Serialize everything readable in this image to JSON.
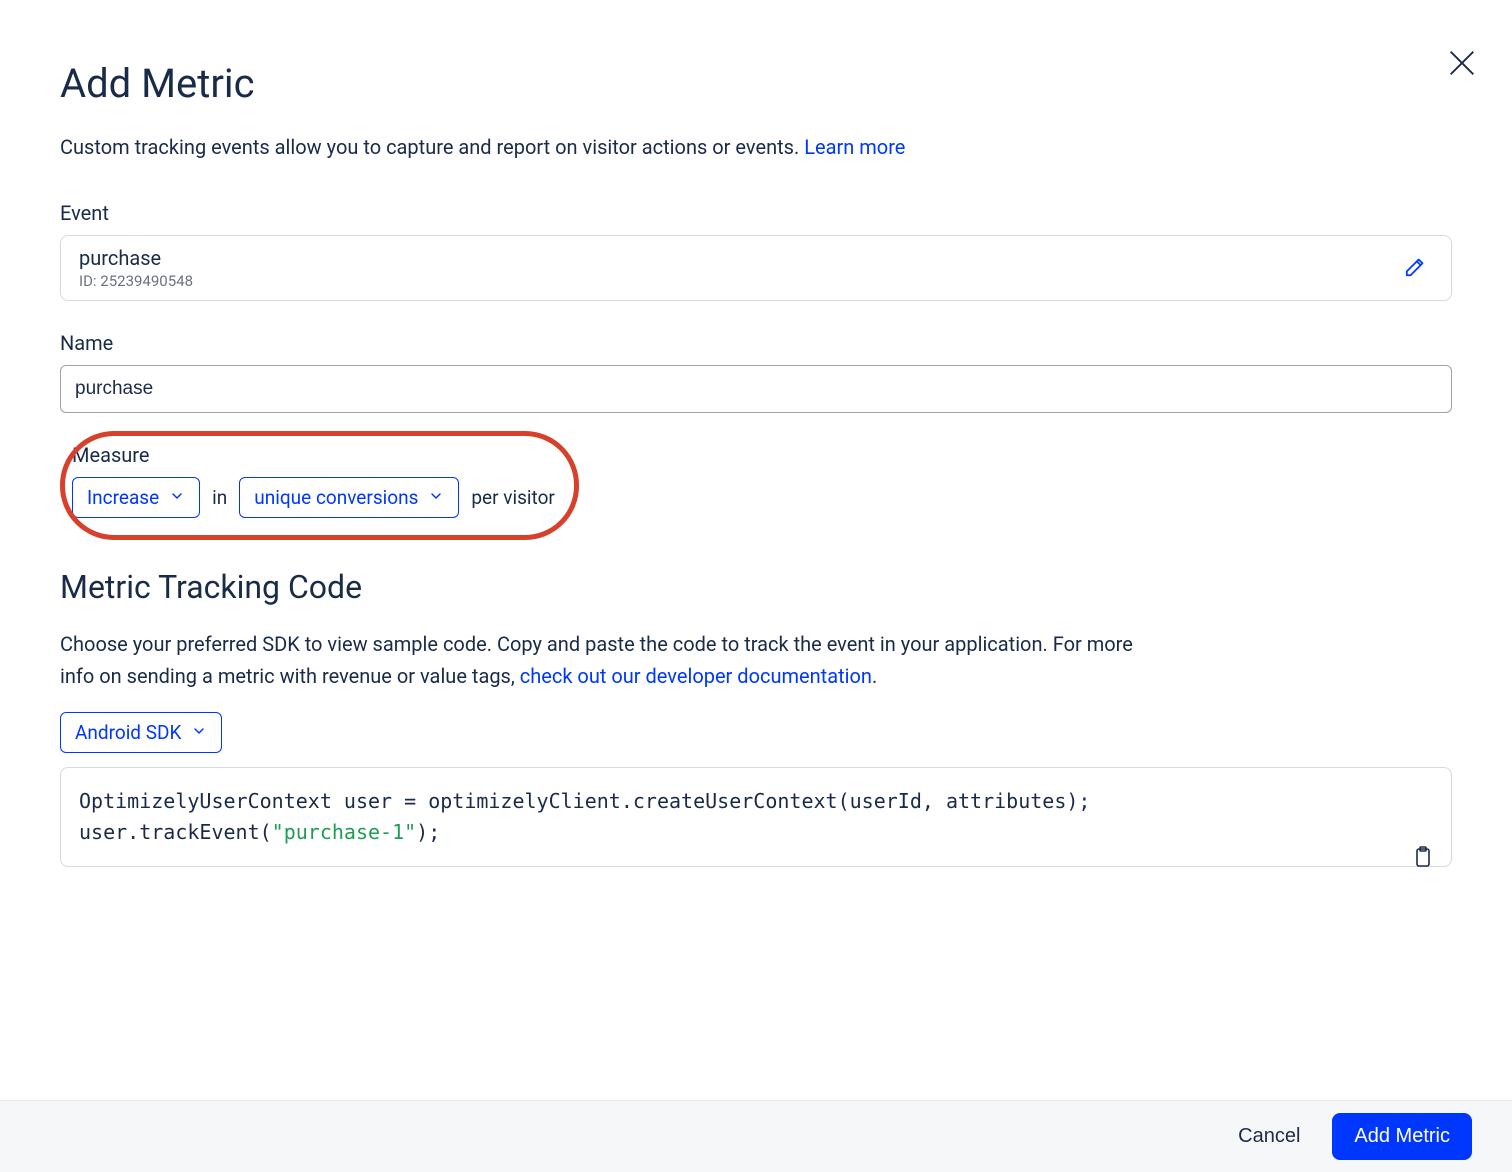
{
  "header": {
    "title": "Add Metric",
    "intro_text": "Custom tracking events allow you to capture and report on visitor actions or events. ",
    "learn_more_label": "Learn more"
  },
  "event_field": {
    "label": "Event",
    "name": "purchase",
    "id_prefix": "ID: ",
    "id_value": "25239490548"
  },
  "name_field": {
    "label": "Name",
    "value": "purchase"
  },
  "measure": {
    "label": "Measure",
    "direction_value": "Increase",
    "joiner_in": "in",
    "count_type_value": "unique conversions",
    "per_label": "per visitor"
  },
  "code_section": {
    "title": "Metric Tracking Code",
    "desc_prefix": "Choose your preferred SDK to view sample code. Copy and paste the code to track the event in your application. For more info on sending a metric with revenue or value tags, ",
    "desc_link": "check out our developer documentation",
    "desc_suffix": ".",
    "sdk_value": "Android SDK",
    "code_line1_a": "OptimizelyUserContext user = optimizelyClient.createUserContext(userId, attributes);",
    "code_line2_a": "user.trackEvent(",
    "code_line2_str": "\"purchase-1\"",
    "code_line2_b": ");"
  },
  "footer": {
    "cancel_label": "Cancel",
    "submit_label": "Add Metric"
  }
}
